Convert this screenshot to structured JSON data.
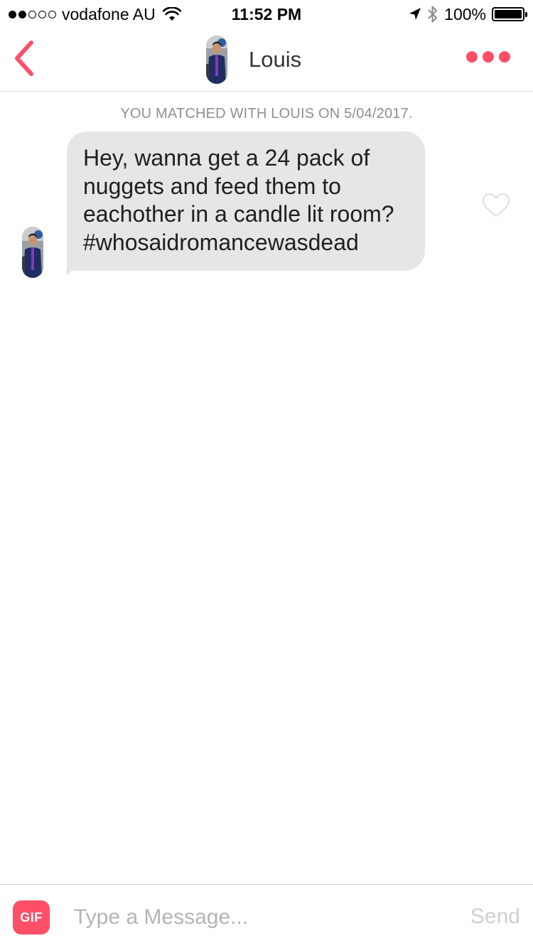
{
  "status_bar": {
    "signal_bars": 2,
    "carrier": "vodafone AU",
    "time": "11:52 PM",
    "battery_percent": "100%",
    "battery_level": 1.0,
    "icons": [
      "wifi-icon",
      "location-arrow-icon",
      "bluetooth-icon",
      "battery-icon"
    ]
  },
  "nav": {
    "back_icon": "chevron-left-icon",
    "contact_name": "Louis",
    "more_icon": "more-dots-icon"
  },
  "chat": {
    "match_note": "YOU MATCHED WITH LOUIS ON 5/04/2017.",
    "messages": [
      {
        "sender": "Louis",
        "text": "Hey, wanna get a 24 pack of\nnuggets and feed them to\neachother in a candle lit room?\n#whosaidromancewasdead",
        "liked": false
      }
    ]
  },
  "composer": {
    "gif_label": "GIF",
    "placeholder": "Type a Message...",
    "send_label": "Send"
  },
  "colors": {
    "accent": "#fd4f68",
    "bubble": "#e6e6e6",
    "muted_text": "#8f8f8f"
  }
}
